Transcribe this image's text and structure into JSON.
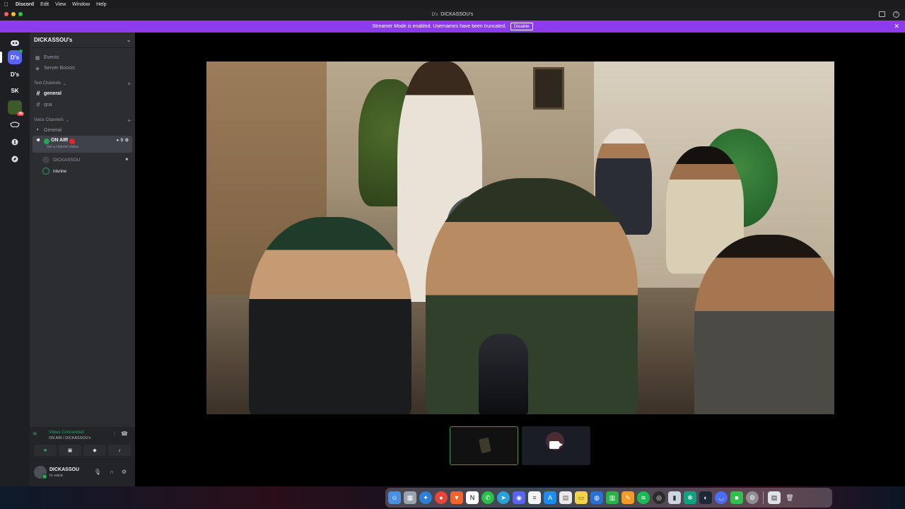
{
  "menubar": {
    "app_name": "Discord",
    "items": [
      "Edit",
      "View",
      "Window",
      "Help"
    ]
  },
  "window": {
    "title_icon": "D's",
    "title": "DICKASSOU's"
  },
  "banner": {
    "text": "Streamer Mode is enabled. Usernames have been truncated.",
    "disable_label": "Disable",
    "color": "#8c3cf0"
  },
  "servers": [
    {
      "label": "D's"
    },
    {
      "label": "D's"
    },
    {
      "label": "SK"
    },
    {
      "label": "",
      "badge": "46"
    }
  ],
  "sidebar": {
    "server_name": "DICKASSOU's",
    "events_label": "Events",
    "boosts_label": "Server Boosts",
    "text_category": "Text Channels",
    "text_channels": [
      "general",
      "qna"
    ],
    "voice_category": "Voice Channels",
    "voice_channels": {
      "general": "General",
      "on_air": "ON AIR",
      "on_air_status": "Set a channel status"
    },
    "voice_users": [
      "DICKASSOU",
      "nisrine"
    ]
  },
  "voice_panel": {
    "status": "Video Connected",
    "channel": "ON AIR / DICKASSOU's"
  },
  "user_panel": {
    "name": "DICKASSOU",
    "status": "In voice"
  },
  "colors": {
    "accent": "#5865f2",
    "online": "#23a55a",
    "sidebar": "#2b2d31",
    "rail": "#1e1f22"
  },
  "icons": {
    "dock": [
      "finder-icon",
      "launchpad-icon",
      "safari-icon",
      "chrome-icon",
      "brave-icon",
      "notion-icon",
      "whatsapp-icon",
      "telegram-icon",
      "discord-icon",
      "notes-icon",
      "app-store-icon",
      "files-icon",
      "stickies-icon",
      "vpn-icon",
      "numbers-icon",
      "pages-icon",
      "spotify-icon",
      "obs-icon",
      "tool-icon",
      "chatgpt-icon",
      "steam-icon",
      "messenger-icon",
      "facetime-icon",
      "settings-icon",
      "downloads-icon",
      "trash-icon"
    ]
  }
}
